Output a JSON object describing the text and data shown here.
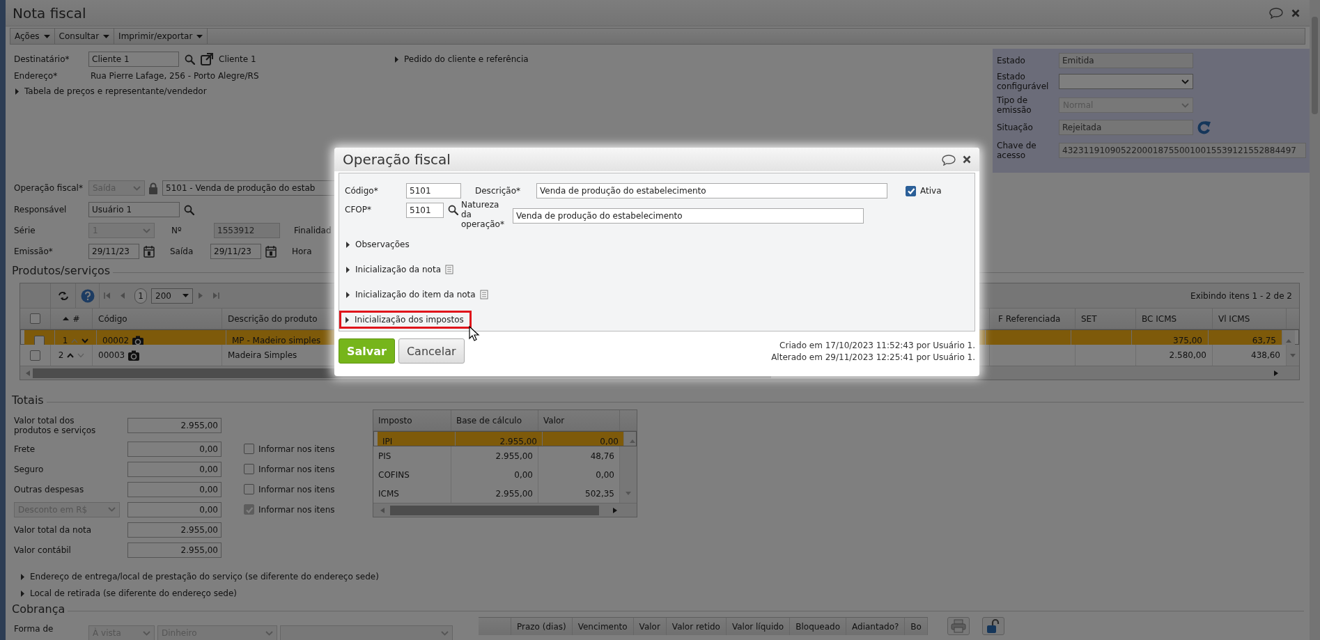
{
  "window": {
    "title": "Nota fiscal"
  },
  "menu": [
    {
      "label": "Ações"
    },
    {
      "label": "Consultar"
    },
    {
      "label": "Imprimir/exportar"
    }
  ],
  "recipient": {
    "label": "Destinatário*",
    "value": "Cliente 1",
    "link": "Cliente 1"
  },
  "address": {
    "label": "Endereço*",
    "value": "Rua Pierre Lafage, 256 - Porto Alegre/RS"
  },
  "toggles_top": [
    {
      "label": "Tabela de preços e representante/vendedor",
      "expanded": false
    },
    {
      "label": "Pedido do cliente e referência",
      "expanded": false
    }
  ],
  "status_panel": [
    {
      "kind": "text",
      "label": "Estado",
      "value": "Emitida",
      "disabled": true
    },
    {
      "kind": "select",
      "label": "Estado configurável",
      "disabled": false
    },
    {
      "kind": "select",
      "label": "Tipo de emissão",
      "value": "Normal",
      "disabled": true
    },
    {
      "kind": "text_refresh",
      "label": "Situação",
      "value": "Rejeitada",
      "disabled": true
    },
    {
      "kind": "text",
      "label": "Chave de acesso",
      "value": "43231191090522000187550010015539121552884497",
      "disabled": true
    }
  ],
  "operation": {
    "label": "Operação fiscal*",
    "type": "Saída",
    "value": "5101 - Venda de produção do estab"
  },
  "responsible": {
    "label": "Responsável",
    "value": "Usuário 1"
  },
  "series": {
    "label": "Série",
    "value": "1"
  },
  "number": {
    "label": "Nº",
    "value": "1553912"
  },
  "purpose": {
    "label": "Finalidad"
  },
  "issue_date": {
    "label": "Emissão*",
    "value": "29/11/23"
  },
  "exit_date": {
    "label": "Saída",
    "value": "29/11/23"
  },
  "time": {
    "label": "Hora"
  },
  "products": {
    "title": "Produtos/serviços",
    "page": "1",
    "page_size": "200",
    "summary": "Exibindo itens 1 - 2 de 2",
    "all_checked": false,
    "columns": [
      "#",
      "Código",
      "Descrição do produto",
      "F Referenciada",
      "SET",
      "BC ICMS",
      "Vl ICMS"
    ],
    "rows": [
      {
        "selected": true,
        "checked": false,
        "number": "1",
        "can_move_up": false,
        "can_move_down": true,
        "code": "00002",
        "description": "MP - Madeiro simples",
        "bc_icms": "375,00",
        "vl_icms": "63,75"
      },
      {
        "selected": false,
        "checked": false,
        "number": "2",
        "can_move_up": true,
        "can_move_down": false,
        "code": "00003",
        "description": "Madeira Simples",
        "bc_icms": "2.580,00",
        "vl_icms": "438,60"
      }
    ]
  },
  "totals": {
    "title": "Totais",
    "fields": [
      {
        "kind": "field",
        "label": "Valor total dos produtos e serviços",
        "value": "2.955,00"
      },
      {
        "kind": "field",
        "label": "Frete",
        "value": "0,00",
        "inform": {
          "label": "Informar nos itens",
          "checked": false,
          "disabled": false
        }
      },
      {
        "kind": "field",
        "label": "Seguro",
        "value": "0,00",
        "inform": {
          "label": "Informar nos itens",
          "checked": false,
          "disabled": false
        }
      },
      {
        "kind": "field",
        "label": "Outras despesas",
        "value": "0,00",
        "inform": {
          "label": "Informar nos itens",
          "checked": false,
          "disabled": false
        }
      },
      {
        "kind": "select",
        "label": "Desconto em R$",
        "value": "0,00",
        "inform": {
          "label": "Informar nos itens",
          "checked": true,
          "disabled": true
        }
      },
      {
        "kind": "field",
        "label": "Valor total da nota",
        "value": "2.955,00"
      },
      {
        "kind": "field",
        "label": "Valor contábil",
        "value": "2.955,00"
      }
    ],
    "tax_table": {
      "columns": [
        "Imposto",
        "Base de cálculo",
        "Valor"
      ],
      "rows": [
        {
          "selected": true,
          "tax": "IPI",
          "base": "2.955,00",
          "value": "0,00"
        },
        {
          "selected": false,
          "tax": "PIS",
          "base": "2.955,00",
          "value": "48,76"
        },
        {
          "selected": false,
          "tax": "COFINS",
          "base": "0,00",
          "value": "0,00"
        },
        {
          "selected": false,
          "tax": "ICMS",
          "base": "2.955,00",
          "value": "502,35"
        }
      ]
    }
  },
  "toggles_bottom": [
    {
      "label": "Endereço de entrega/local de prestação do serviço (se diferente do endereço sede)",
      "expanded": false
    },
    {
      "label": "Local de retirada (se diferente do endereço sede)",
      "expanded": false
    }
  ],
  "billing": {
    "title": "Cobrança",
    "label": "Forma de",
    "selects": [
      {
        "value": "À vista"
      },
      {
        "value": "Dinheiro"
      }
    ],
    "columns": [
      "Prazo (dias)",
      "Vencimento",
      "Valor",
      "Valor retido",
      "Valor líquido",
      "Bloqueado",
      "Adiantado?",
      "Bo"
    ]
  },
  "dialog": {
    "title": "Operação fiscal",
    "code": {
      "label": "Código*",
      "value": "5101"
    },
    "description": {
      "label": "Descrição*",
      "value": "Venda de produção do estabelecimento"
    },
    "cfop": {
      "label": "CFOP*",
      "value": "5101"
    },
    "nature": {
      "label": "Natureza da operação*",
      "value": "Venda de produção do estabelecimento"
    },
    "active": {
      "label": "Ativa",
      "checked": true
    },
    "sections": [
      {
        "label": "Observações",
        "expanded": false,
        "notes": false,
        "highlighted": false
      },
      {
        "label": "Inicialização da nota",
        "expanded": false,
        "notes": true,
        "highlighted": false
      },
      {
        "label": "Inicialização do item da nota",
        "expanded": false,
        "notes": true,
        "highlighted": false
      },
      {
        "label": "Inicialização dos impostos",
        "expanded": false,
        "notes": false,
        "highlighted": true
      }
    ],
    "buttons": [
      {
        "kind": "primary",
        "label": "Salvar"
      },
      {
        "kind": "secondary",
        "label": "Cancelar"
      }
    ],
    "audit": [
      "Criado em 17/10/2023 11:52:43 por Usuário 1.",
      "Alterado em 29/11/2023 12:25:41 por Usuário 1."
    ]
  }
}
